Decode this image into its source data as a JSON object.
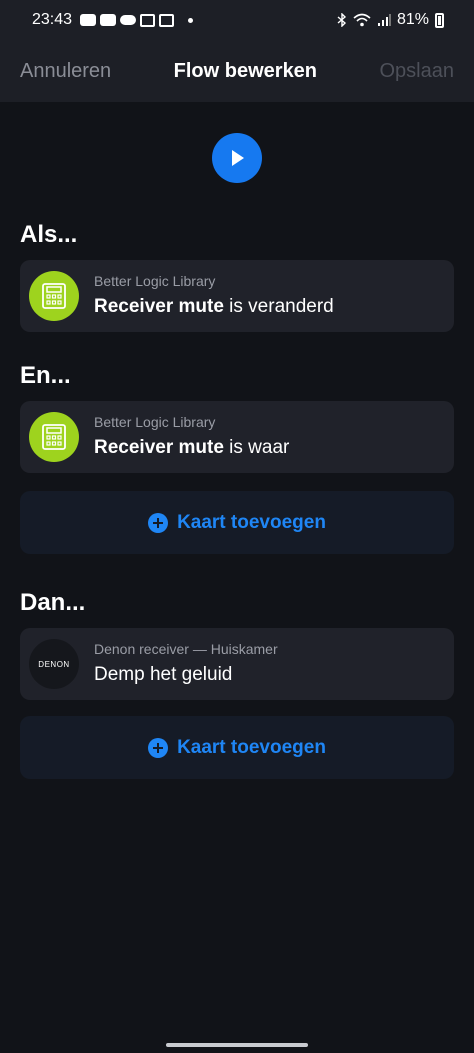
{
  "status_bar": {
    "time": "23:43",
    "battery": "81%"
  },
  "header": {
    "cancel_label": "Annuleren",
    "title": "Flow bewerken",
    "save_label": "Opslaan"
  },
  "play_icon": "play-icon",
  "sections": {
    "when": {
      "heading": "Als...",
      "card": {
        "app": "Better Logic Library",
        "bold": "Receiver mute",
        "rest": " is veranderd",
        "icon": "calculator-icon"
      }
    },
    "and": {
      "heading": "En...",
      "card": {
        "app": "Better Logic Library",
        "bold": "Receiver mute",
        "rest": " is waar",
        "icon": "calculator-icon"
      },
      "add_label": "Kaart toevoegen"
    },
    "then": {
      "heading": "Dan...",
      "card": {
        "app": "Denon receiver — Huiskamer",
        "text": "Demp het geluid",
        "logo_text": "DENON"
      },
      "add_label": "Kaart toevoegen"
    }
  },
  "colors": {
    "accent": "#1679f0",
    "logic_green": "#9ed31e",
    "background": "#111318",
    "card": "#20222a"
  }
}
